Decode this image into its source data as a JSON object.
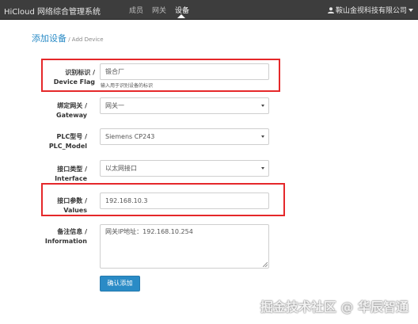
{
  "navbar": {
    "brand": "HiCloud 网络综合管理系统",
    "items": [
      "成员",
      "网关",
      "设备"
    ],
    "active_index": 2,
    "user_name": "鞍山金视科技有限公司"
  },
  "page": {
    "title": "添加设备",
    "subtitle": " / Add Device"
  },
  "form": {
    "device_flag": {
      "label_cn": "识别标识 /",
      "label_en": "Device Flag",
      "value": "锻合厂",
      "hint": "输入用于识别设备的标识"
    },
    "gateway": {
      "label_cn": "绑定网关 /",
      "label_en": "Gateway",
      "selected": "网关一"
    },
    "plc_model": {
      "label_cn": "PLC型号 /",
      "label_en": "PLC_Model",
      "selected": "Siemens CP243"
    },
    "interface": {
      "label_cn": "接口类型 /",
      "label_en": "Interface",
      "selected": "以太网接口"
    },
    "values": {
      "label_cn": "接口参数 /",
      "label_en": "Values",
      "value": "192.168.10.3"
    },
    "information": {
      "label_cn": "备注信息 /",
      "label_en": "Information",
      "value": "网关IP地址：192.168.10.254"
    },
    "submit_label": "确认添加"
  },
  "colors": {
    "accent": "#2a8bc6",
    "highlight": "#e5282a",
    "navbar_bg": "#3d3d3d"
  },
  "watermark": "掘金技术社区 @ 华辰智通"
}
